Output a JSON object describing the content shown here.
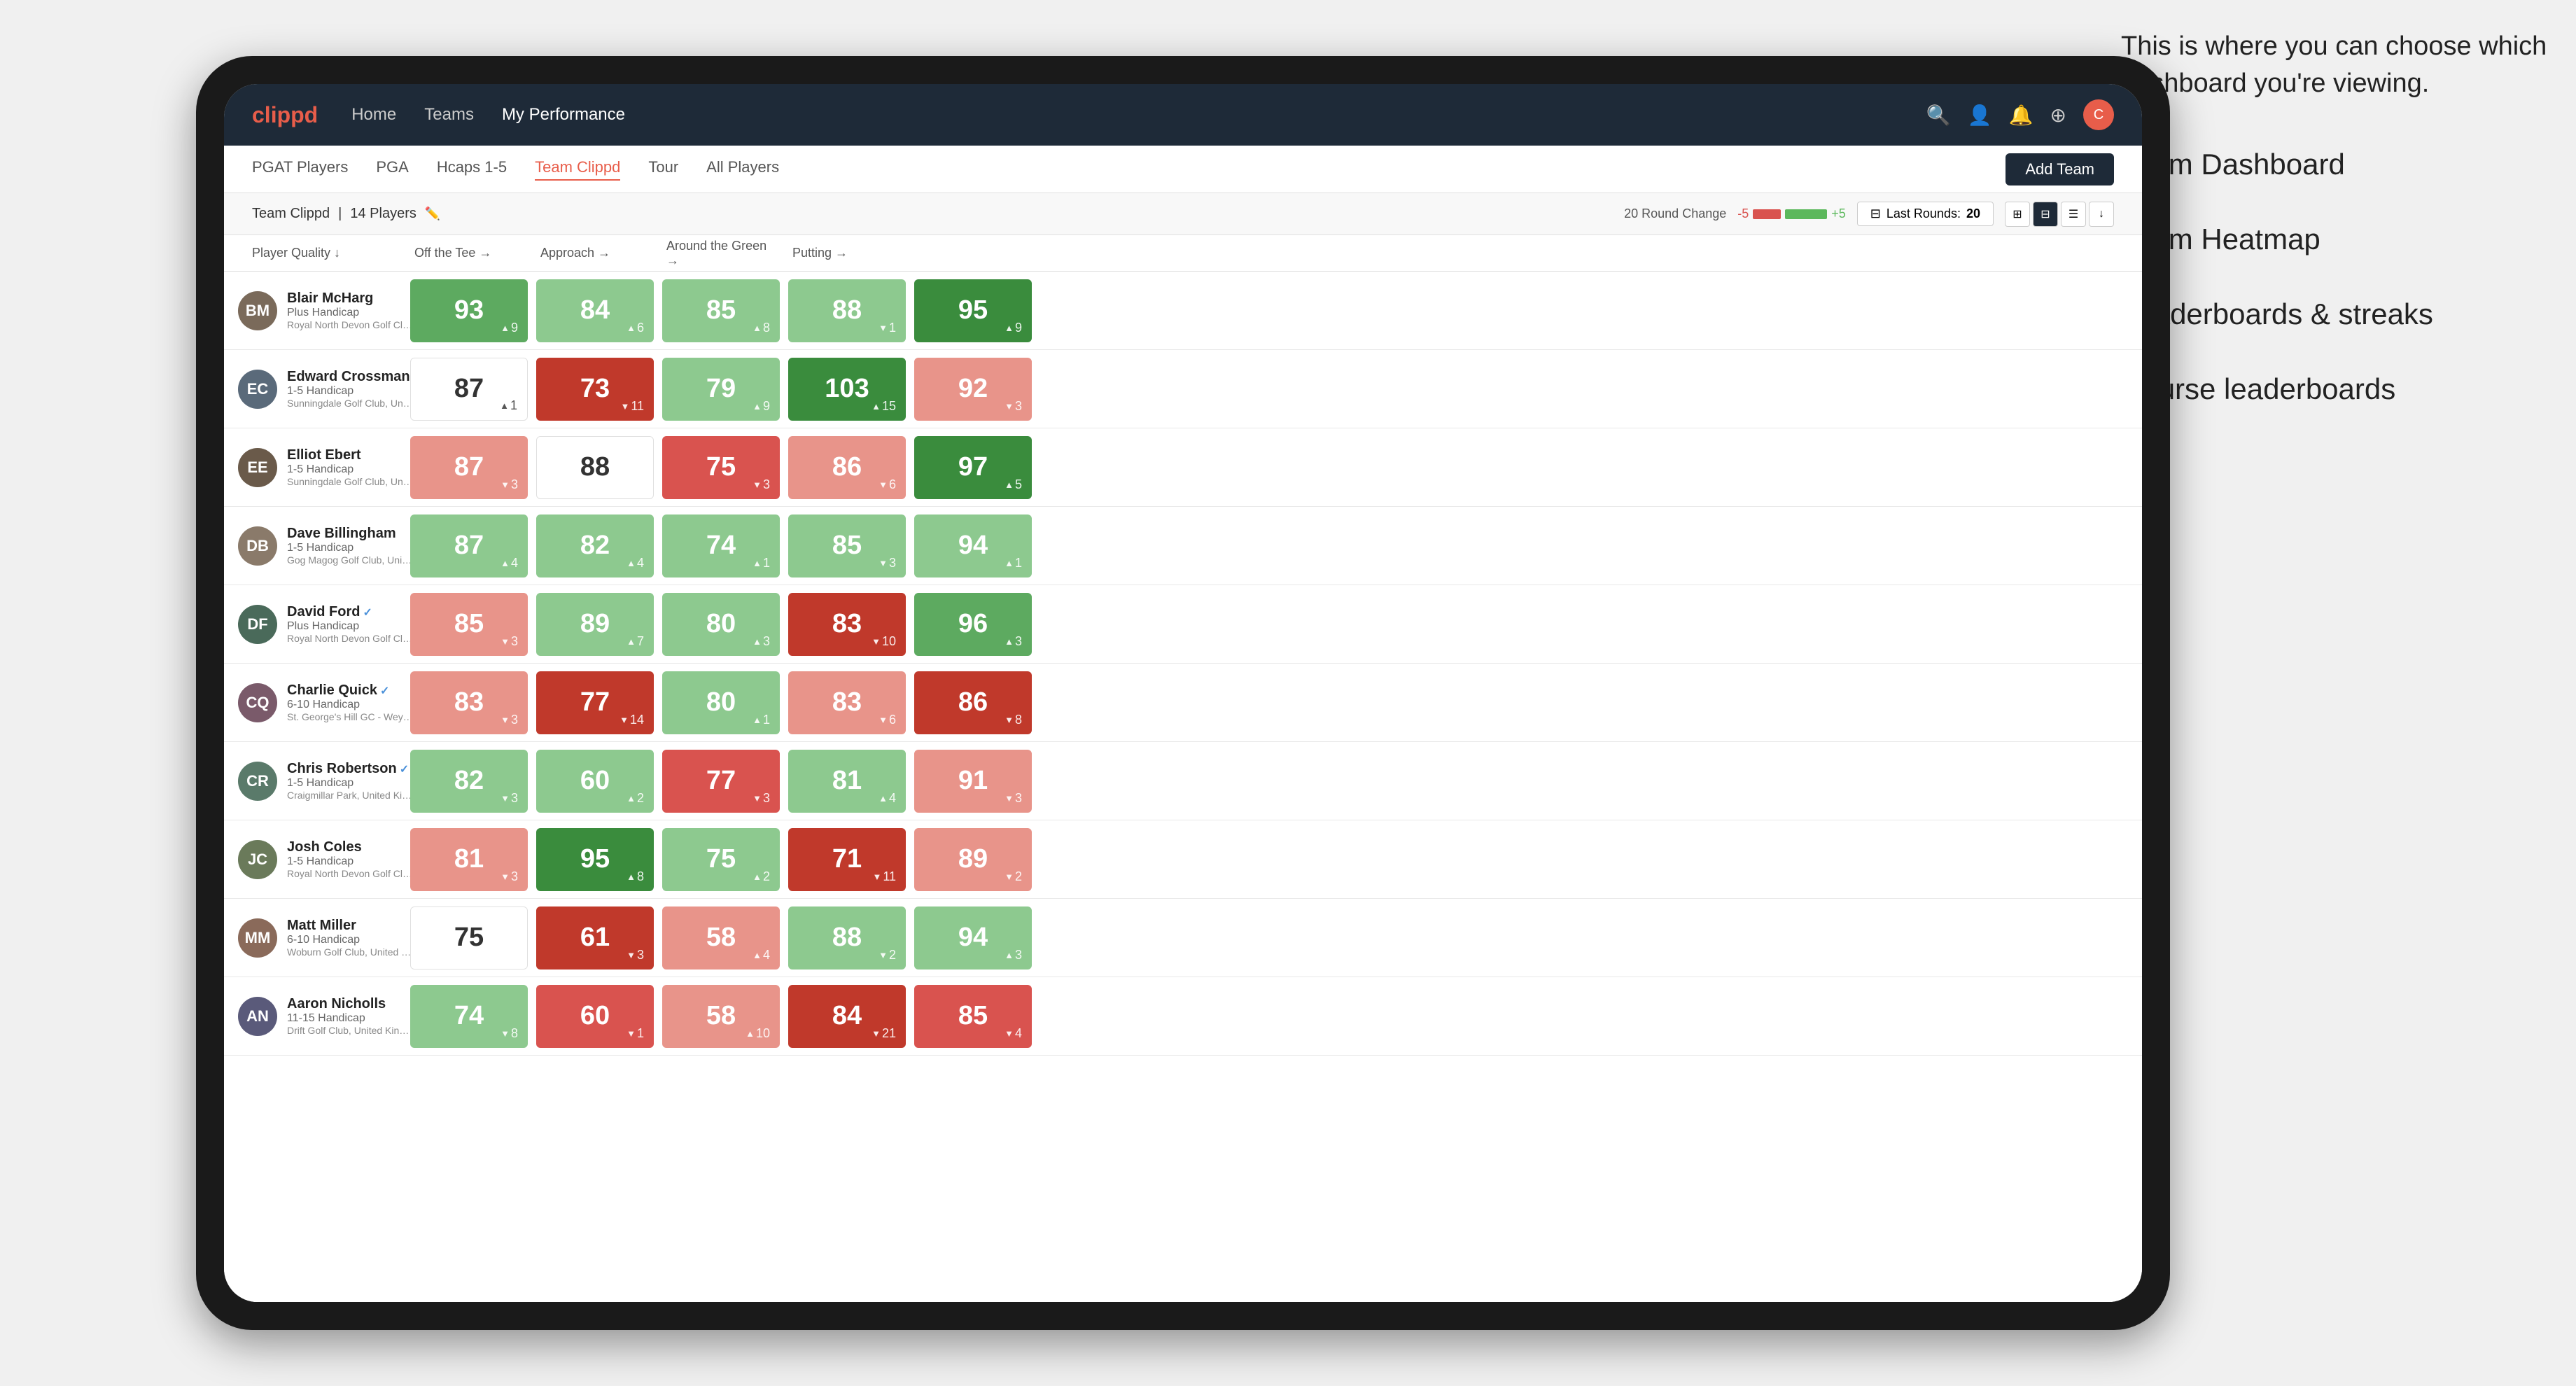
{
  "annotation": {
    "intro": "This is where you can choose which dashboard you're viewing.",
    "items": [
      "Team Dashboard",
      "Team Heatmap",
      "Leaderboards & streaks",
      "Course leaderboards"
    ]
  },
  "nav": {
    "logo": "clippd",
    "links": [
      "Home",
      "Teams",
      "My Performance"
    ],
    "active_link": "My Performance",
    "icons": [
      "🔍",
      "👤",
      "🔔",
      "⊕"
    ]
  },
  "sub_nav": {
    "links": [
      "PGAT Players",
      "PGA",
      "Hcaps 1-5",
      "Team Clippd",
      "Tour",
      "All Players"
    ],
    "active": "Team Clippd",
    "add_button": "Add Team"
  },
  "team_bar": {
    "team_name": "Team Clippd",
    "player_count": "14 Players",
    "round_change_label": "20 Round Change",
    "round_change_neg": "-5",
    "round_change_pos": "+5",
    "last_rounds_label": "Last Rounds:",
    "last_rounds_value": "20"
  },
  "table": {
    "columns": [
      "Player Quality ↓",
      "Off the Tee →",
      "Approach →",
      "Around the Green →",
      "Putting →"
    ],
    "players": [
      {
        "name": "Blair McHarg",
        "handicap": "Plus Handicap",
        "club": "Royal North Devon Golf Club, United Kingdom",
        "avatar_color": "#7a6a5a",
        "scores": [
          {
            "value": 93,
            "change": "+9",
            "dir": "up",
            "bg": "green-mid"
          },
          {
            "value": 84,
            "change": "+6",
            "dir": "up",
            "bg": "green-light"
          },
          {
            "value": 85,
            "change": "+8",
            "dir": "up",
            "bg": "green-light"
          },
          {
            "value": 88,
            "change": "-1",
            "dir": "down",
            "bg": "green-light"
          },
          {
            "value": 95,
            "change": "+9",
            "dir": "up",
            "bg": "green-dark"
          }
        ]
      },
      {
        "name": "Edward Crossman",
        "handicap": "1-5 Handicap",
        "club": "Sunningdale Golf Club, United Kingdom",
        "avatar_color": "#5a6a7a",
        "scores": [
          {
            "value": 87,
            "change": "+1",
            "dir": "up",
            "bg": "white"
          },
          {
            "value": 73,
            "change": "-11",
            "dir": "down",
            "bg": "red-dark"
          },
          {
            "value": 79,
            "change": "+9",
            "dir": "up",
            "bg": "green-light"
          },
          {
            "value": 103,
            "change": "+15",
            "dir": "up",
            "bg": "green-dark"
          },
          {
            "value": 92,
            "change": "-3",
            "dir": "down",
            "bg": "red-light"
          }
        ]
      },
      {
        "name": "Elliot Ebert",
        "handicap": "1-5 Handicap",
        "club": "Sunningdale Golf Club, United Kingdom",
        "avatar_color": "#6a5a4a",
        "scores": [
          {
            "value": 87,
            "change": "-3",
            "dir": "down",
            "bg": "red-light"
          },
          {
            "value": 88,
            "change": "",
            "dir": "",
            "bg": "white"
          },
          {
            "value": 75,
            "change": "-3",
            "dir": "down",
            "bg": "red-mid"
          },
          {
            "value": 86,
            "change": "-6",
            "dir": "down",
            "bg": "red-light"
          },
          {
            "value": 97,
            "change": "+5",
            "dir": "up",
            "bg": "green-dark"
          }
        ]
      },
      {
        "name": "Dave Billingham",
        "handicap": "1-5 Handicap",
        "club": "Gog Magog Golf Club, United Kingdom",
        "avatar_color": "#8a7a6a",
        "scores": [
          {
            "value": 87,
            "change": "+4",
            "dir": "up",
            "bg": "green-light"
          },
          {
            "value": 82,
            "change": "+4",
            "dir": "up",
            "bg": "green-light"
          },
          {
            "value": 74,
            "change": "+1",
            "dir": "up",
            "bg": "green-light"
          },
          {
            "value": 85,
            "change": "-3",
            "dir": "down",
            "bg": "green-light"
          },
          {
            "value": 94,
            "change": "+1",
            "dir": "up",
            "bg": "green-light"
          }
        ]
      },
      {
        "name": "David Ford",
        "handicap": "Plus Handicap",
        "club": "Royal North Devon Golf Club, United Kingdom",
        "avatar_color": "#4a6a5a",
        "verified": true,
        "scores": [
          {
            "value": 85,
            "change": "-3",
            "dir": "down",
            "bg": "red-light"
          },
          {
            "value": 89,
            "change": "+7",
            "dir": "up",
            "bg": "green-light"
          },
          {
            "value": 80,
            "change": "+3",
            "dir": "up",
            "bg": "green-light"
          },
          {
            "value": 83,
            "change": "-10",
            "dir": "down",
            "bg": "red-dark"
          },
          {
            "value": 96,
            "change": "+3",
            "dir": "up",
            "bg": "green-mid"
          }
        ]
      },
      {
        "name": "Charlie Quick",
        "handicap": "6-10 Handicap",
        "club": "St. George's Hill GC - Weybridge - Surrey, Uni...",
        "avatar_color": "#7a5a6a",
        "verified": true,
        "scores": [
          {
            "value": 83,
            "change": "-3",
            "dir": "down",
            "bg": "red-light"
          },
          {
            "value": 77,
            "change": "-14",
            "dir": "down",
            "bg": "red-dark"
          },
          {
            "value": 80,
            "change": "+1",
            "dir": "up",
            "bg": "green-light"
          },
          {
            "value": 83,
            "change": "-6",
            "dir": "down",
            "bg": "red-light"
          },
          {
            "value": 86,
            "change": "-8",
            "dir": "down",
            "bg": "red-dark"
          }
        ]
      },
      {
        "name": "Chris Robertson",
        "handicap": "1-5 Handicap",
        "club": "Craigmillar Park, United Kingdom",
        "avatar_color": "#5a7a6a",
        "verified": true,
        "scores": [
          {
            "value": 82,
            "change": "-3",
            "dir": "down",
            "bg": "green-light"
          },
          {
            "value": 60,
            "change": "+2",
            "dir": "up",
            "bg": "green-light"
          },
          {
            "value": 77,
            "change": "-3",
            "dir": "down",
            "bg": "red-mid"
          },
          {
            "value": 81,
            "change": "+4",
            "dir": "up",
            "bg": "green-light"
          },
          {
            "value": 91,
            "change": "-3",
            "dir": "down",
            "bg": "red-light"
          }
        ]
      },
      {
        "name": "Josh Coles",
        "handicap": "1-5 Handicap",
        "club": "Royal North Devon Golf Club, United Kingdom",
        "avatar_color": "#6a7a5a",
        "scores": [
          {
            "value": 81,
            "change": "-3",
            "dir": "down",
            "bg": "red-light"
          },
          {
            "value": 95,
            "change": "+8",
            "dir": "up",
            "bg": "green-dark"
          },
          {
            "value": 75,
            "change": "+2",
            "dir": "up",
            "bg": "green-light"
          },
          {
            "value": 71,
            "change": "-11",
            "dir": "down",
            "bg": "red-dark"
          },
          {
            "value": 89,
            "change": "-2",
            "dir": "down",
            "bg": "red-light"
          }
        ]
      },
      {
        "name": "Matt Miller",
        "handicap": "6-10 Handicap",
        "club": "Woburn Golf Club, United Kingdom",
        "avatar_color": "#8a6a5a",
        "scores": [
          {
            "value": 75,
            "change": "",
            "dir": "",
            "bg": "white"
          },
          {
            "value": 61,
            "change": "-3",
            "dir": "down",
            "bg": "red-dark"
          },
          {
            "value": 58,
            "change": "+4",
            "dir": "up",
            "bg": "red-light"
          },
          {
            "value": 88,
            "change": "-2",
            "dir": "down",
            "bg": "green-light"
          },
          {
            "value": 94,
            "change": "+3",
            "dir": "up",
            "bg": "green-light"
          }
        ]
      },
      {
        "name": "Aaron Nicholls",
        "handicap": "11-15 Handicap",
        "club": "Drift Golf Club, United Kingdom",
        "avatar_color": "#5a5a7a",
        "scores": [
          {
            "value": 74,
            "change": "-8",
            "dir": "down",
            "bg": "green-light"
          },
          {
            "value": 60,
            "change": "-1",
            "dir": "down",
            "bg": "red-mid"
          },
          {
            "value": 58,
            "change": "+10",
            "dir": "up",
            "bg": "red-light"
          },
          {
            "value": 84,
            "change": "-21",
            "dir": "down",
            "bg": "red-dark"
          },
          {
            "value": 85,
            "change": "-4",
            "dir": "down",
            "bg": "red-mid"
          }
        ]
      }
    ]
  }
}
